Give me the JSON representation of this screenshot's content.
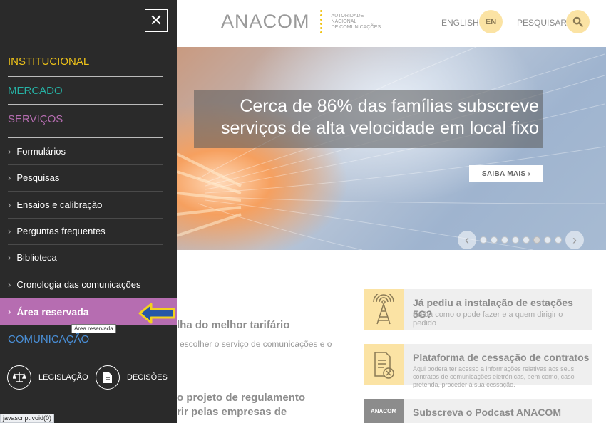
{
  "header": {
    "logo_word": "ANACOM",
    "logo_sub": [
      "AUTORIDADE",
      "NACIONAL",
      "DE COMUNICAÇÕES"
    ],
    "english_label": "ENGLISH",
    "en_badge": "EN",
    "search_label": "PESQUISAR"
  },
  "hero": {
    "title_line1": "Cerca de 86% das famílias subscreve",
    "title_line2": "serviços de alta velocidade em local fixo",
    "button_label": "SAIBA MAIS ›",
    "slides_total": 8,
    "active_slide": 6
  },
  "content": {
    "left_heading1": "lha do melhor tarifário",
    "left_text1": "escolher o serviço de comunicações e o",
    "left_heading2_line1": "o projeto de regulamento",
    "left_heading2_line2": "rir pelas empresas de",
    "cards": [
      {
        "title": "Já pediu a instalação de estações 5G?",
        "subtitle": "Saiba como o pode fazer e a quem dirigir o pedido"
      },
      {
        "title": "Plataforma de cessação de contratos",
        "subtitle": "Aqui poderá ter acesso a informações relativas aos seus contratos de comunicações eletrónicas, bem como, caso pretenda, proceder à sua cessação."
      },
      {
        "title": "Subscreva o Podcast ANACOM",
        "subtitle": "",
        "badge": "ANACOM"
      }
    ]
  },
  "sidebar": {
    "categories": [
      {
        "label": "INSTITUCIONAL",
        "color": "#f0c419"
      },
      {
        "label": "MERCADO",
        "color": "#26b1a4"
      },
      {
        "label": "SERVIÇOS",
        "color": "#b66db1"
      },
      {
        "label": "COMUNICAÇÃO",
        "color": "#4a90d9"
      }
    ],
    "items": [
      {
        "label": "Formulários"
      },
      {
        "label": "Pesquisas"
      },
      {
        "label": "Ensaios e calibração"
      },
      {
        "label": "Perguntas frequentes"
      },
      {
        "label": "Biblioteca"
      },
      {
        "label": "Cronologia das comunicações"
      },
      {
        "label": "Área reservada"
      }
    ],
    "legislacao_label": "LEGISLAÇÃO",
    "decisoes_label": "DECISÕES",
    "tooltip": "Área reservada"
  },
  "statusbar": {
    "text": "javascript:void(0)"
  },
  "colors": {
    "accent_yellow": "#fbe3a4",
    "services_purple": "#b66db1"
  }
}
